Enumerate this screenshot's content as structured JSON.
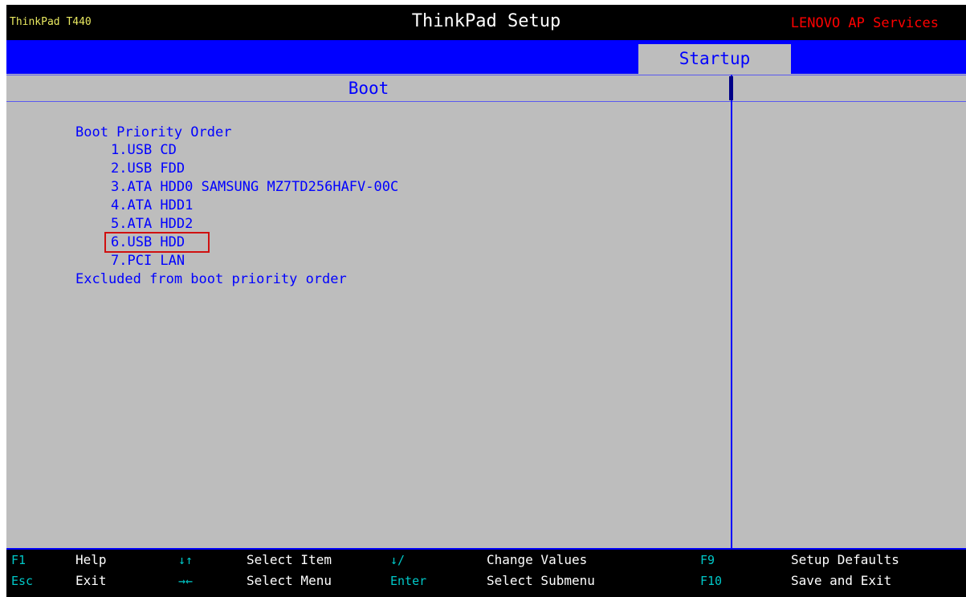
{
  "header": {
    "model": "ThinkPad T440",
    "title": "ThinkPad Setup",
    "vendor": "LENOVO AP Services"
  },
  "tabs": [
    {
      "label": "Startup",
      "active": true
    }
  ],
  "section": {
    "title": "Boot"
  },
  "boot": {
    "priority_heading": "Boot Priority Order",
    "items": [
      {
        "label": "1.USB CD"
      },
      {
        "label": "2.USB FDD"
      },
      {
        "label": "3.ATA HDD0 SAMSUNG MZ7TD256HAFV-00C"
      },
      {
        "label": "4.ATA HDD1"
      },
      {
        "label": "5.ATA HDD2"
      },
      {
        "label": "6.USB HDD",
        "highlighted": true
      },
      {
        "label": "7.PCI LAN"
      }
    ],
    "excluded_heading": "Excluded from boot priority order"
  },
  "footer": {
    "row1": [
      {
        "key": "F1",
        "desc": "Help"
      },
      {
        "key": "↓↑",
        "desc": "Select Item"
      },
      {
        "key": "↓/",
        "desc": "Change Values"
      },
      {
        "key": "F9",
        "desc": "Setup Defaults"
      }
    ],
    "row2": [
      {
        "key": "Esc",
        "desc": "Exit"
      },
      {
        "key": "→←",
        "desc": "Select Menu"
      },
      {
        "key": "Enter",
        "desc": "Select Submenu"
      },
      {
        "key": "F10",
        "desc": "Save and Exit"
      }
    ]
  },
  "colors": {
    "background": "#bdbdbd",
    "accent_blue": "#0000ff",
    "title_bar": "#000000",
    "vendor_red": "#ff0000",
    "model_yellow": "#e8e860",
    "key_cyan": "#00c8c8",
    "highlight_red": "#d01010"
  }
}
